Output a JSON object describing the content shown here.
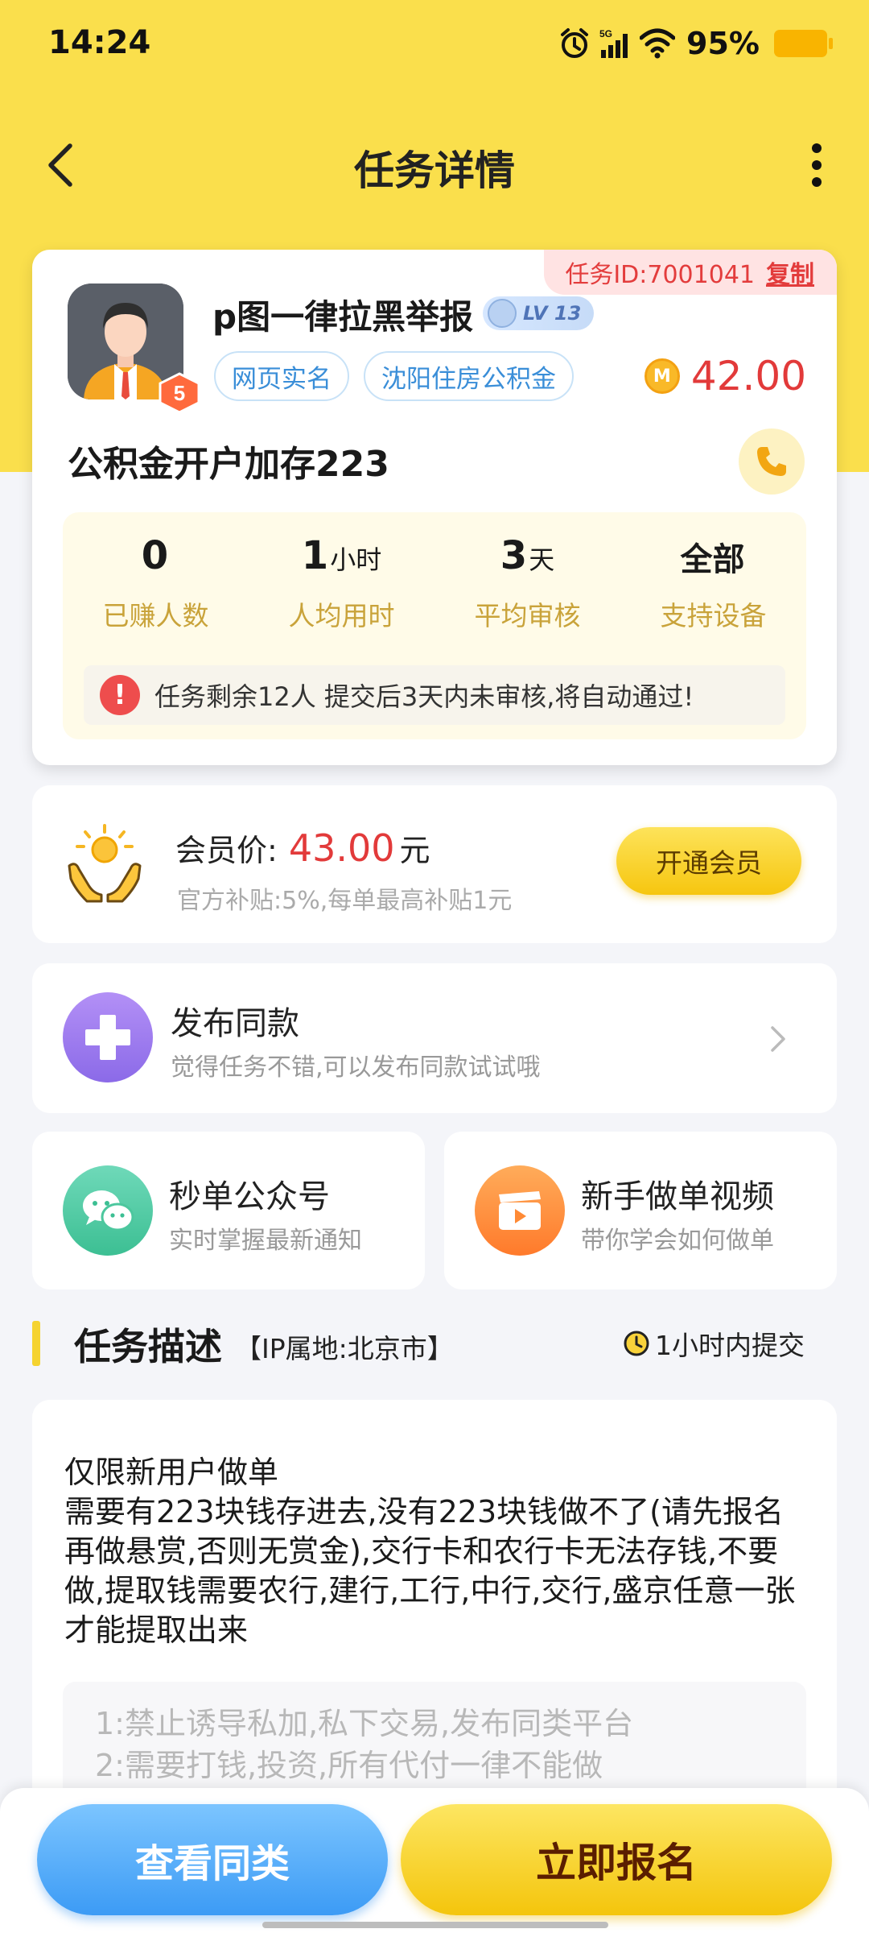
{
  "status_bar": {
    "time": "14:24",
    "network": "5G",
    "battery": "95%"
  },
  "nav": {
    "title": "任务详情"
  },
  "task_card": {
    "task_id": "任务ID:7001041",
    "copy_label": "复制",
    "publisher_name": "p图一律拉黑举报",
    "level": "LV 13",
    "avatar_badge": "5",
    "tags": [
      "网页实名",
      "沈阳住房公积金"
    ],
    "coin_symbol": "M",
    "reward": "42.00",
    "title": "公积金开户加存223",
    "stats": [
      {
        "value": "0",
        "unit": "",
        "label": "已赚人数"
      },
      {
        "value": "1",
        "unit": "小时",
        "label": "人均用时"
      },
      {
        "value": "3",
        "unit": "天",
        "label": "平均审核"
      },
      {
        "value": "全部",
        "unit": "",
        "label": "支持设备"
      }
    ],
    "notice": "任务剩余12人  提交后3天内未审核,将自动通过!"
  },
  "member": {
    "label": "会员价:",
    "price": "43.00",
    "unit": "元",
    "subsidy": "官方补贴:5%,每单最高补贴1元",
    "button": "开通会员"
  },
  "publish_same": {
    "title": "发布同款",
    "subtitle": "觉得任务不错,可以发布同款试试哦"
  },
  "quick_links": [
    {
      "title": "秒单公众号",
      "subtitle": "实时掌握最新通知"
    },
    {
      "title": "新手做单视频",
      "subtitle": "带你学会如何做单"
    }
  ],
  "description": {
    "section_title": "任务描述",
    "ip_location": "【IP属地:北京市】",
    "time_limit": "1小时内提交",
    "text": "仅限新用户做单\n需要有223块钱存进去,没有223块钱做不了(请先报名再做悬赏,否则无赏金),交行卡和农行卡无法存钱,不要做,提取钱需要农行,建行,工行,中行,交行,盛京任意一张才能提取出来",
    "rules": [
      "1:禁止诱导私加,私下交易,发布同类平台",
      "2:需要打钱,投资,所有代付一律不能做"
    ]
  },
  "bottom": {
    "similar_button": "查看同类",
    "signup_button": "立即报名"
  }
}
